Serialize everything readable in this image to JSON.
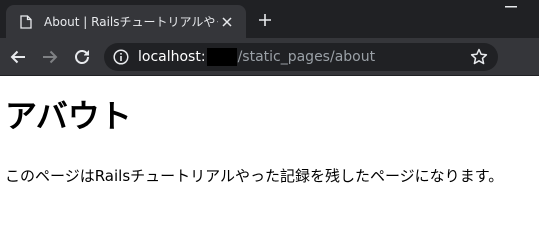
{
  "browser": {
    "tab": {
      "title": "About | Railsチュートリアルやったよ!!"
    },
    "address_bar": {
      "host": "localhost:",
      "path": "/static_pages/about"
    },
    "colors": {
      "tabstrip": "#202124",
      "toolbar": "#35363a",
      "omnibox": "#202124",
      "url_path": "#9aa0a6"
    }
  },
  "page": {
    "heading": "アバウト",
    "body_text": "このページはRailsチュートリアルやった記録を残したページになります。"
  }
}
